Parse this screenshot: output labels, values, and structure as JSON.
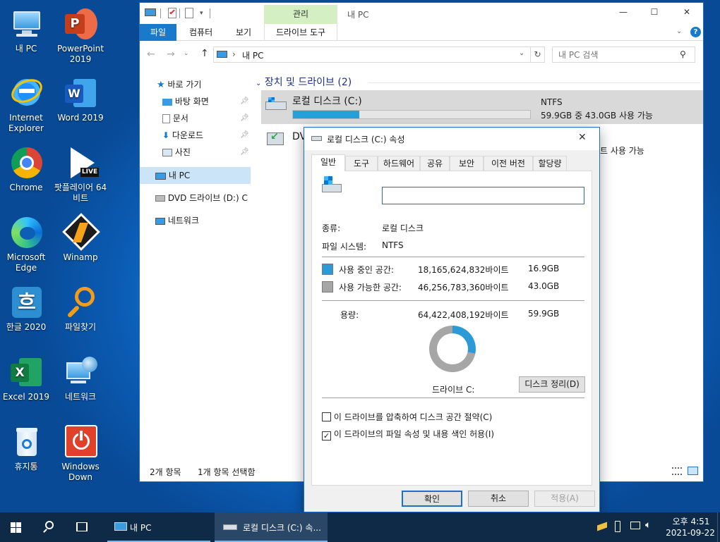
{
  "desktop": {
    "icons": [
      {
        "label": "내 PC",
        "icon": "this-pc-icon"
      },
      {
        "label": "PowerPoint 2019",
        "icon": "powerpoint-icon"
      },
      {
        "label": "Internet Explorer",
        "icon": "internet-explorer-icon"
      },
      {
        "label": "Word 2019",
        "icon": "word-icon"
      },
      {
        "label": "Chrome",
        "icon": "chrome-icon"
      },
      {
        "label": "팟플레이어 64 비트",
        "icon": "potplayer-icon",
        "badge": "LIVE"
      },
      {
        "label": "Microsoft Edge",
        "icon": "edge-icon"
      },
      {
        "label": "Winamp",
        "icon": "winamp-icon"
      },
      {
        "label": "한글 2020",
        "icon": "hangul-icon",
        "glyph": "흐"
      },
      {
        "label": "파일찾기",
        "icon": "file-search-icon"
      },
      {
        "label": "Excel 2019",
        "icon": "excel-icon"
      },
      {
        "label": "네트워크",
        "icon": "network-icon"
      },
      {
        "label": "휴지통",
        "icon": "recycle-bin-icon"
      },
      {
        "label": "Windows Down",
        "icon": "power-icon"
      }
    ],
    "app_letters": {
      "powerpoint": "P",
      "word": "W",
      "excel": "X"
    }
  },
  "explorer": {
    "title": "내 PC",
    "contextual_tab": "관리",
    "ribbon_tabs": [
      "파일",
      "컴퓨터",
      "보기",
      "드라이브 도구"
    ],
    "window_buttons": {
      "minimize": "—",
      "maximize": "☐",
      "close": "✕"
    },
    "address": {
      "path": "내 PC",
      "separator": "›"
    },
    "search_placeholder": "내 PC 검색",
    "nav": {
      "quick_access": "바로 가기",
      "desktop": "바탕 화면",
      "documents": "문서",
      "downloads": "다운로드",
      "pictures": "사진",
      "this_pc": "내 PC",
      "dvd": "DVD 드라이브 (D:) C",
      "network": "네트워크"
    },
    "section_title": "장치 및 드라이브 (2)",
    "drives": [
      {
        "name": "로컬 디스크 (C:)",
        "fs": "NTFS",
        "free_text": "59.9GB 중 43.0GB 사용 가능",
        "used_fraction": 0.28
      },
      {
        "name": "DV",
        "free_text": "트 사용 가능"
      }
    ],
    "status": {
      "items": "2개 항목",
      "selected": "1개 항목 선택함"
    }
  },
  "dialog": {
    "title": "로컬 디스크 (C:) 속성",
    "close": "✕",
    "tabs": [
      "일반",
      "도구",
      "하드웨어",
      "공유",
      "보안",
      "이전 버전",
      "할당량"
    ],
    "name_value": "",
    "type_label": "종류:",
    "type_value": "로컬 디스크",
    "fs_label": "파일 시스템:",
    "fs_value": "NTFS",
    "used_label": "사용 중인 공간:",
    "used_bytes": "18,165,624,832바이트",
    "used_size": "16.9GB",
    "free_label": "사용 가능한 공간:",
    "free_bytes": "46,256,783,360바이트",
    "free_size": "43.0GB",
    "capacity_label": "용량:",
    "capacity_bytes": "64,422,408,192바이트",
    "capacity_size": "59.9GB",
    "used_fraction": 0.282,
    "drive_label": "드라이브 C:",
    "cleanup_button": "디스크 정리(D)",
    "compress_label": "이 드라이브를 압축하여 디스크 공간 절약(C)",
    "compress_checked": false,
    "index_label": "이 드라이브의 파일 속성 및 내용 색인 허용(I)",
    "index_checked": true,
    "check_mark": "✓",
    "ok": "확인",
    "cancel": "취소",
    "apply": "적용(A)",
    "colors": {
      "used": "#2b9ad6",
      "free": "#a6a6a6"
    }
  },
  "taskbar": {
    "search_icon": "search-icon",
    "task_view_icon": "task-view-icon",
    "apps": [
      "내 PC",
      "로컬 디스크 (C:) 속..."
    ],
    "time": "오후 4:51",
    "date": "2021-09-22"
  }
}
